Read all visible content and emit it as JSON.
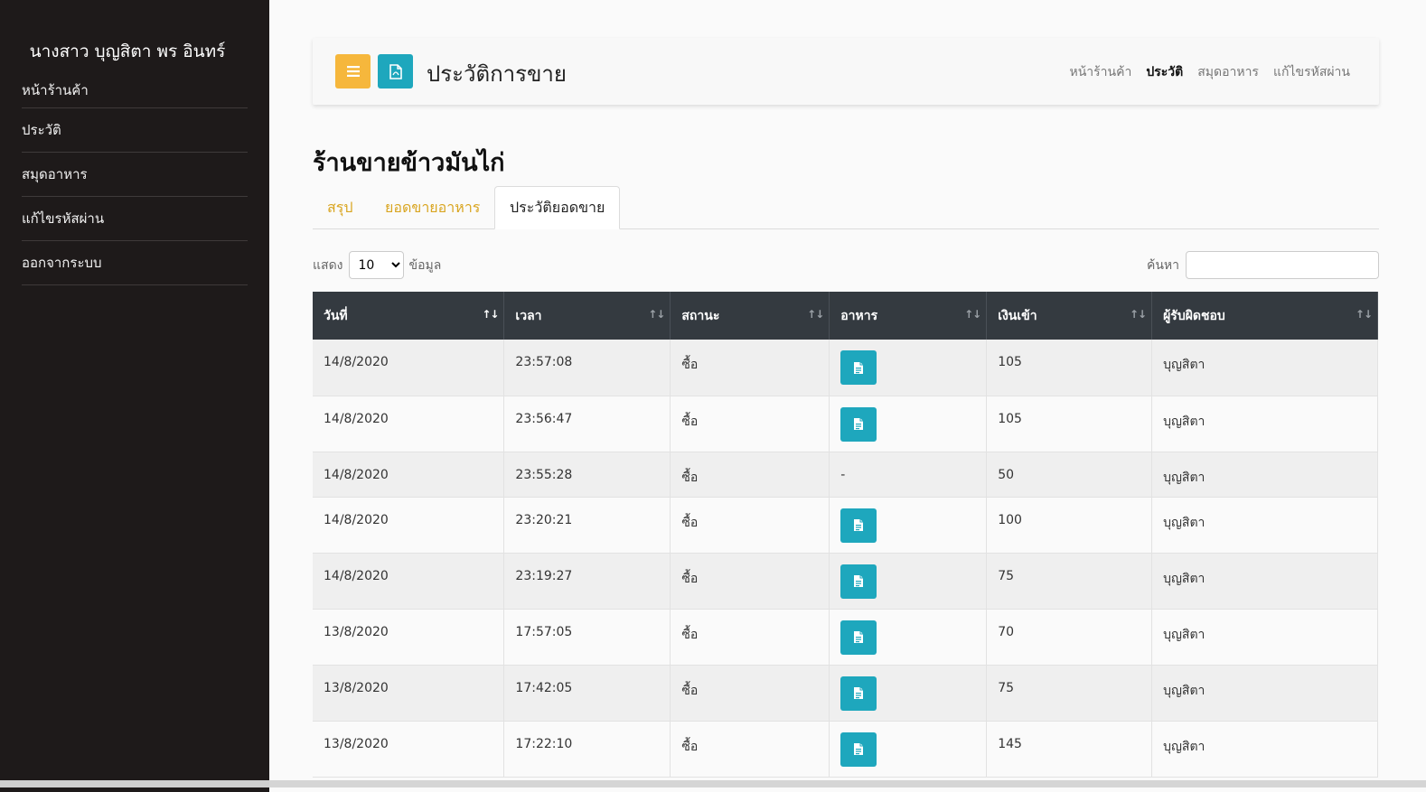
{
  "sidebar": {
    "user_name": "นางสาว บุญสิตา พร อินทร์",
    "items": [
      {
        "label": "หน้าร้านค้า"
      },
      {
        "label": "ประวัติ"
      },
      {
        "label": "สมุดอาหาร"
      },
      {
        "label": "แก้ไขรหัสผ่าน"
      },
      {
        "label": "ออกจากระบบ"
      }
    ]
  },
  "header": {
    "title": "ประวัติการขาย",
    "nav": [
      {
        "label": "หน้าร้านค้า",
        "active": false
      },
      {
        "label": "ประวัติ",
        "active": true
      },
      {
        "label": "สมุดอาหาร",
        "active": false
      },
      {
        "label": "แก้ไขรหัสผ่าน",
        "active": false
      }
    ]
  },
  "shop_title": "ร้านขายข้าวมันไก่",
  "tabs": [
    {
      "label": "สรุป"
    },
    {
      "label": "ยอดขายอาหาร"
    },
    {
      "label": "ประวัติยอดขาย"
    }
  ],
  "table_controls": {
    "show_label": "แสดง",
    "page_size": "10",
    "entries_label": "ข้อมูล",
    "search_label": "ค้นหา"
  },
  "table": {
    "columns": [
      "วันที่",
      "เวลา",
      "สถานะ",
      "อาหาร",
      "เงินเข้า",
      "ผู้รับผิดชอบ"
    ],
    "rows": [
      {
        "date": "14/8/2020",
        "time": "23:57:08",
        "status": "ซื้อ",
        "food": "doc",
        "amount": "105",
        "staff": "บุญสิตา"
      },
      {
        "date": "14/8/2020",
        "time": "23:56:47",
        "status": "ซื้อ",
        "food": "doc",
        "amount": "105",
        "staff": "บุญสิตา"
      },
      {
        "date": "14/8/2020",
        "time": "23:55:28",
        "status": "ซื้อ",
        "food": "-",
        "amount": "50",
        "staff": "บุญสิตา"
      },
      {
        "date": "14/8/2020",
        "time": "23:20:21",
        "status": "ซื้อ",
        "food": "doc",
        "amount": "100",
        "staff": "บุญสิตา"
      },
      {
        "date": "14/8/2020",
        "time": "23:19:27",
        "status": "ซื้อ",
        "food": "doc",
        "amount": "75",
        "staff": "บุญสิตา"
      },
      {
        "date": "13/8/2020",
        "time": "17:57:05",
        "status": "ซื้อ",
        "food": "doc",
        "amount": "70",
        "staff": "บุญสิตา"
      },
      {
        "date": "13/8/2020",
        "time": "17:42:05",
        "status": "ซื้อ",
        "food": "doc",
        "amount": "75",
        "staff": "บุญสิตา"
      },
      {
        "date": "13/8/2020",
        "time": "17:22:10",
        "status": "ซื้อ",
        "food": "doc",
        "amount": "145",
        "staff": "บุญสิตา"
      }
    ]
  },
  "icons": {
    "menu": "hamburger-icon",
    "pdf": "pdf-file-icon",
    "food_detail": "document-icon",
    "sort": "sort-icon"
  },
  "colors": {
    "sidebar_bg": "#1e1a1a",
    "menu_button": "#f6b73c",
    "accent_button": "#1ea7bd",
    "tab_link": "#d9a520",
    "table_header": "#343a40"
  }
}
